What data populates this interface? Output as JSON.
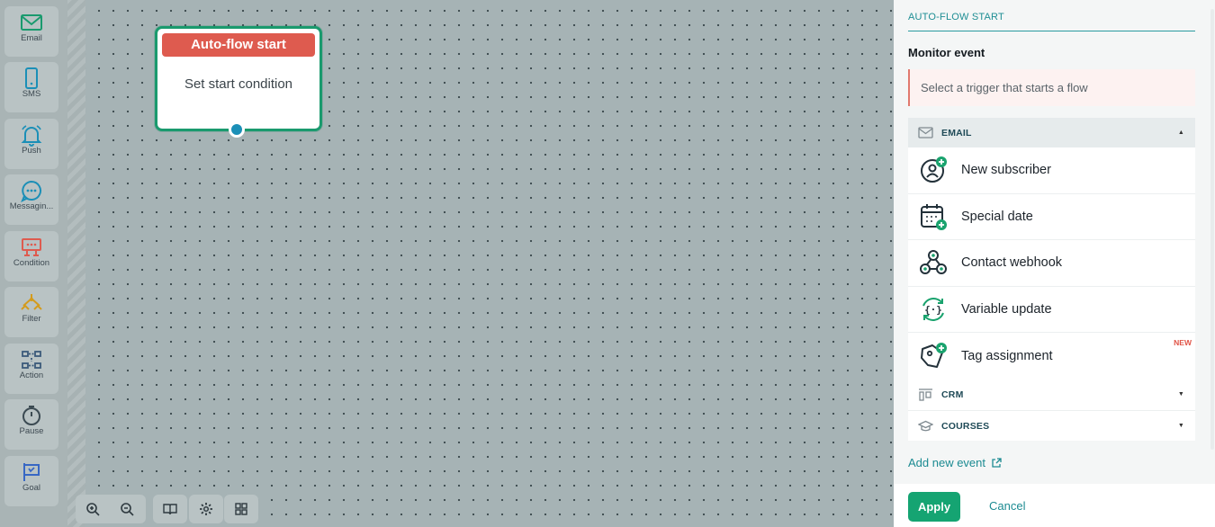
{
  "toolbar": {
    "items": [
      {
        "label": "Email",
        "icon": "mail-icon",
        "color": "#1a9a6e"
      },
      {
        "label": "SMS",
        "icon": "phone-icon",
        "color": "#1b8fb7"
      },
      {
        "label": "Push",
        "icon": "bell-icon",
        "color": "#1b8fb7"
      },
      {
        "label": "Messagin...",
        "icon": "chat-icon",
        "color": "#1b8fb7"
      },
      {
        "label": "Condition",
        "icon": "condition-icon",
        "color": "#de5b4f"
      },
      {
        "label": "Filter",
        "icon": "filter-icon",
        "color": "#d49b1d"
      },
      {
        "label": "Action",
        "icon": "action-icon",
        "color": "#3b5a7a"
      },
      {
        "label": "Pause",
        "icon": "stopwatch-icon",
        "color": "#3b4a52"
      },
      {
        "label": "Goal",
        "icon": "flag-icon",
        "color": "#3767c4"
      }
    ]
  },
  "canvas": {
    "node": {
      "title": "Auto-flow start",
      "body": "Set start condition"
    },
    "controls": [
      "zoom-in-icon",
      "zoom-out-icon",
      "book-icon",
      "gear-icon",
      "grid-icon"
    ]
  },
  "panel": {
    "title": "AUTO-FLOW START",
    "subtitle": "Monitor event",
    "trigger_placeholder": "Select a trigger that starts a flow",
    "sections": {
      "email": {
        "label": "EMAIL",
        "expanded": true,
        "items": [
          {
            "label": "New subscriber",
            "icon": "new-subscriber-icon"
          },
          {
            "label": "Special date",
            "icon": "calendar-icon"
          },
          {
            "label": "Contact webhook",
            "icon": "webhook-icon"
          },
          {
            "label": "Variable update",
            "icon": "variable-icon"
          },
          {
            "label": "Tag assignment",
            "icon": "tag-icon",
            "badge": "NEW"
          }
        ]
      },
      "crm": {
        "label": "CRM",
        "expanded": false
      },
      "courses": {
        "label": "COURSES",
        "expanded": false
      }
    },
    "add_event": "Add new event",
    "apply": "Apply",
    "cancel": "Cancel"
  },
  "colors": {
    "accent": "#15a472",
    "link": "#1c8b92",
    "node_header": "#de5b4f",
    "badge": "#e05447"
  }
}
